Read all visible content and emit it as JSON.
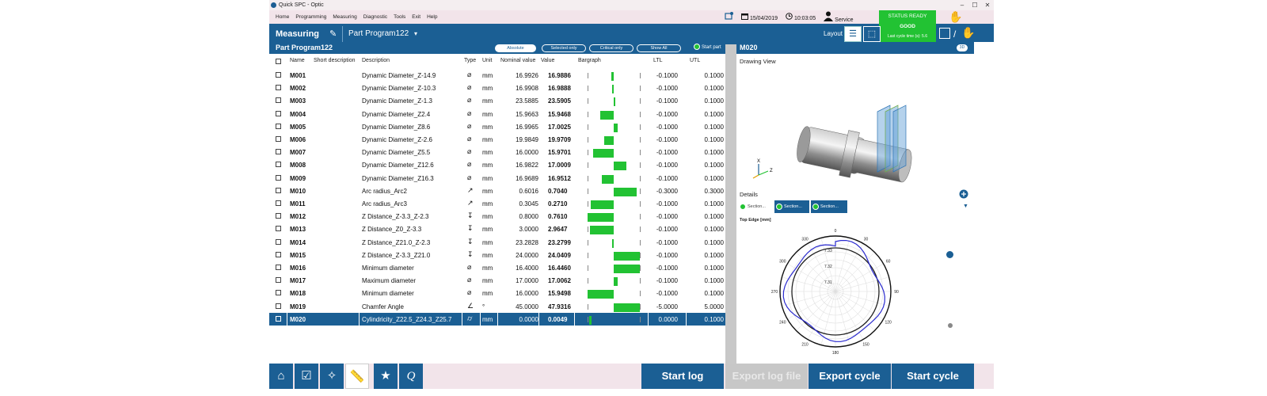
{
  "window": {
    "title": "Quick SPC - Optic",
    "controls": [
      "–",
      "☐",
      "✕"
    ]
  },
  "menu": [
    "Home",
    "Programming",
    "Measuring",
    "Diagnostic",
    "Tools",
    "Exit",
    "Help"
  ],
  "top_status": {
    "date": "15/04/2019",
    "time": "10:03:05",
    "user": "Service"
  },
  "status_panel": {
    "ready": "STATUS READY",
    "result": "GOOD",
    "cycle_time": "Last cycle time (s): 5.6",
    "color": "#22c233"
  },
  "toolbar": {
    "mode": "Measuring",
    "program": "Part Program122",
    "layout_label": "Layout"
  },
  "list": {
    "title": "Part Program122",
    "filters": [
      "Absolute",
      "Selected only",
      "Critical only",
      "Show All"
    ],
    "selected_filter": "Absolute",
    "start_part": "Start part",
    "columns": [
      "Name",
      "Short description",
      "Description",
      "Type",
      "Unit",
      "Nominal value",
      "Value",
      "Bargraph",
      "LTL",
      "UTL"
    ],
    "rows": [
      {
        "name": "M001",
        "desc": "Dynamic Diameter_Z-14.9",
        "type": "dyn-diameter-icon",
        "unit": "mm",
        "nominal": "16.9926",
        "value": "16.9886",
        "ltl": "-0.1000",
        "utl": "0.1000",
        "deviation": -0.004
      },
      {
        "name": "M002",
        "desc": "Dynamic Diameter_Z-10.3",
        "type": "dyn-diameter-icon",
        "unit": "mm",
        "nominal": "16.9908",
        "value": "16.9888",
        "ltl": "-0.1000",
        "utl": "0.1000",
        "deviation": -0.002
      },
      {
        "name": "M003",
        "desc": "Dynamic Diameter_Z-1.3",
        "type": "dyn-diameter-icon",
        "unit": "mm",
        "nominal": "23.5885",
        "value": "23.5905",
        "ltl": "-0.1000",
        "utl": "0.1000",
        "deviation": 0.002
      },
      {
        "name": "M004",
        "desc": "Dynamic Diameter_Z2.4",
        "type": "dyn-diameter-icon",
        "unit": "mm",
        "nominal": "15.9663",
        "value": "15.9468",
        "ltl": "-0.1000",
        "utl": "0.1000",
        "deviation": -0.0195
      },
      {
        "name": "M005",
        "desc": "Dynamic Diameter_Z8.6",
        "type": "dyn-diameter-icon",
        "unit": "mm",
        "nominal": "16.9965",
        "value": "17.0025",
        "ltl": "-0.1000",
        "utl": "0.1000",
        "deviation": 0.006
      },
      {
        "name": "M006",
        "desc": "Dynamic Diameter_Z-2.6",
        "type": "dyn-diameter-icon",
        "unit": "mm",
        "nominal": "19.9849",
        "value": "19.9709",
        "ltl": "-0.1000",
        "utl": "0.1000",
        "deviation": -0.014
      },
      {
        "name": "M007",
        "desc": "Dynamic Diameter_Z5.5",
        "type": "dyn-diameter-icon",
        "unit": "mm",
        "nominal": "16.0000",
        "value": "15.9701",
        "ltl": "-0.1000",
        "utl": "0.1000",
        "deviation": -0.0299
      },
      {
        "name": "M008",
        "desc": "Dynamic Diameter_Z12.6",
        "type": "dyn-diameter-icon",
        "unit": "mm",
        "nominal": "16.9822",
        "value": "17.0009",
        "ltl": "-0.1000",
        "utl": "0.1000",
        "deviation": 0.0187
      },
      {
        "name": "M009",
        "desc": "Dynamic Diameter_Z16.3",
        "type": "dyn-diameter-icon",
        "unit": "mm",
        "nominal": "16.9689",
        "value": "16.9512",
        "ltl": "-0.1000",
        "utl": "0.1000",
        "deviation": -0.0177
      },
      {
        "name": "M010",
        "desc": "Arc radius_Arc2",
        "type": "arc-radius-icon",
        "unit": "mm",
        "nominal": "0.6016",
        "value": "0.7040",
        "ltl": "-0.3000",
        "utl": "0.3000",
        "deviation": 0.1024
      },
      {
        "name": "M011",
        "desc": "Arc radius_Arc3",
        "type": "arc-radius-icon",
        "unit": "mm",
        "nominal": "0.3045",
        "value": "0.2710",
        "ltl": "-0.1000",
        "utl": "0.1000",
        "deviation": -0.0335
      },
      {
        "name": "M012",
        "desc": "Z Distance_Z-3.3_Z-2.3",
        "type": "z-distance-icon",
        "unit": "mm",
        "nominal": "0.8000",
        "value": "0.7610",
        "ltl": "-0.1000",
        "utl": "0.1000",
        "deviation": -0.039
      },
      {
        "name": "M013",
        "desc": "Z Distance_Z0_Z-3.3",
        "type": "z-distance-icon",
        "unit": "mm",
        "nominal": "3.0000",
        "value": "2.9647",
        "ltl": "-0.1000",
        "utl": "0.1000",
        "deviation": -0.0353
      },
      {
        "name": "M014",
        "desc": "Z Distance_Z21.0_Z-2.3",
        "type": "z-distance-icon",
        "unit": "mm",
        "nominal": "23.2828",
        "value": "23.2799",
        "ltl": "-0.1000",
        "utl": "0.1000",
        "deviation": -0.0029
      },
      {
        "name": "M015",
        "desc": "Z Distance_Z-3.3_Z21.0",
        "type": "z-distance-icon",
        "unit": "mm",
        "nominal": "24.0000",
        "value": "24.0409",
        "ltl": "-0.1000",
        "utl": "0.1000",
        "deviation": 0.0409
      },
      {
        "name": "M016",
        "desc": "Minimum diameter",
        "type": "diameter-icon",
        "unit": "mm",
        "nominal": "16.4000",
        "value": "16.4460",
        "ltl": "-0.1000",
        "utl": "0.1000",
        "deviation": 0.046
      },
      {
        "name": "M017",
        "desc": "Maximum diameter",
        "type": "diameter-icon",
        "unit": "mm",
        "nominal": "17.0000",
        "value": "17.0062",
        "ltl": "-0.1000",
        "utl": "0.1000",
        "deviation": 0.0062
      },
      {
        "name": "M018",
        "desc": "Minimum diameter",
        "type": "diameter-icon",
        "unit": "mm",
        "nominal": "16.0000",
        "value": "15.9498",
        "ltl": "-0.1000",
        "utl": "0.1000",
        "deviation": -0.0502
      },
      {
        "name": "M019",
        "desc": "Chamfer Angle",
        "type": "angle-icon",
        "unit": "°",
        "nominal": "45.0000",
        "value": "47.9316",
        "ltl": "-5.0000",
        "utl": "5.0000",
        "deviation": 2.9316
      },
      {
        "name": "M020",
        "desc": "Cylindricity_Z22.5_Z24.3_Z25.7",
        "type": "cylindricity-icon",
        "unit": "mm",
        "nominal": "0.0000",
        "value": "0.0049",
        "ltl": "0.0000",
        "utl": "0.1000",
        "deviation": 0.0049,
        "selected": true
      }
    ]
  },
  "right_panel": {
    "title": "M020",
    "toggle": "3D",
    "drawing_view": "Drawing View",
    "details": "Details",
    "sections": [
      "Section...",
      "Section...",
      "Section..."
    ],
    "plot_title": "Top Edge [mm]",
    "angles": [
      "0",
      "30",
      "60",
      "90",
      "120",
      "150",
      "180",
      "210",
      "240",
      "270",
      "300",
      "330"
    ],
    "radial_labels": [
      "7.33",
      "7.32",
      "7.31"
    ],
    "axis_labels": [
      "X",
      "Z"
    ]
  },
  "bottom": {
    "icons": [
      "home-icon",
      "checklist-icon",
      "wrench-icon",
      "ruler-icon",
      "star-icon",
      "q-icon"
    ],
    "start_log": "Start log",
    "export_log_file": "Export log file",
    "export_cycle": "Export cycle",
    "start_cycle": "Start cycle"
  }
}
